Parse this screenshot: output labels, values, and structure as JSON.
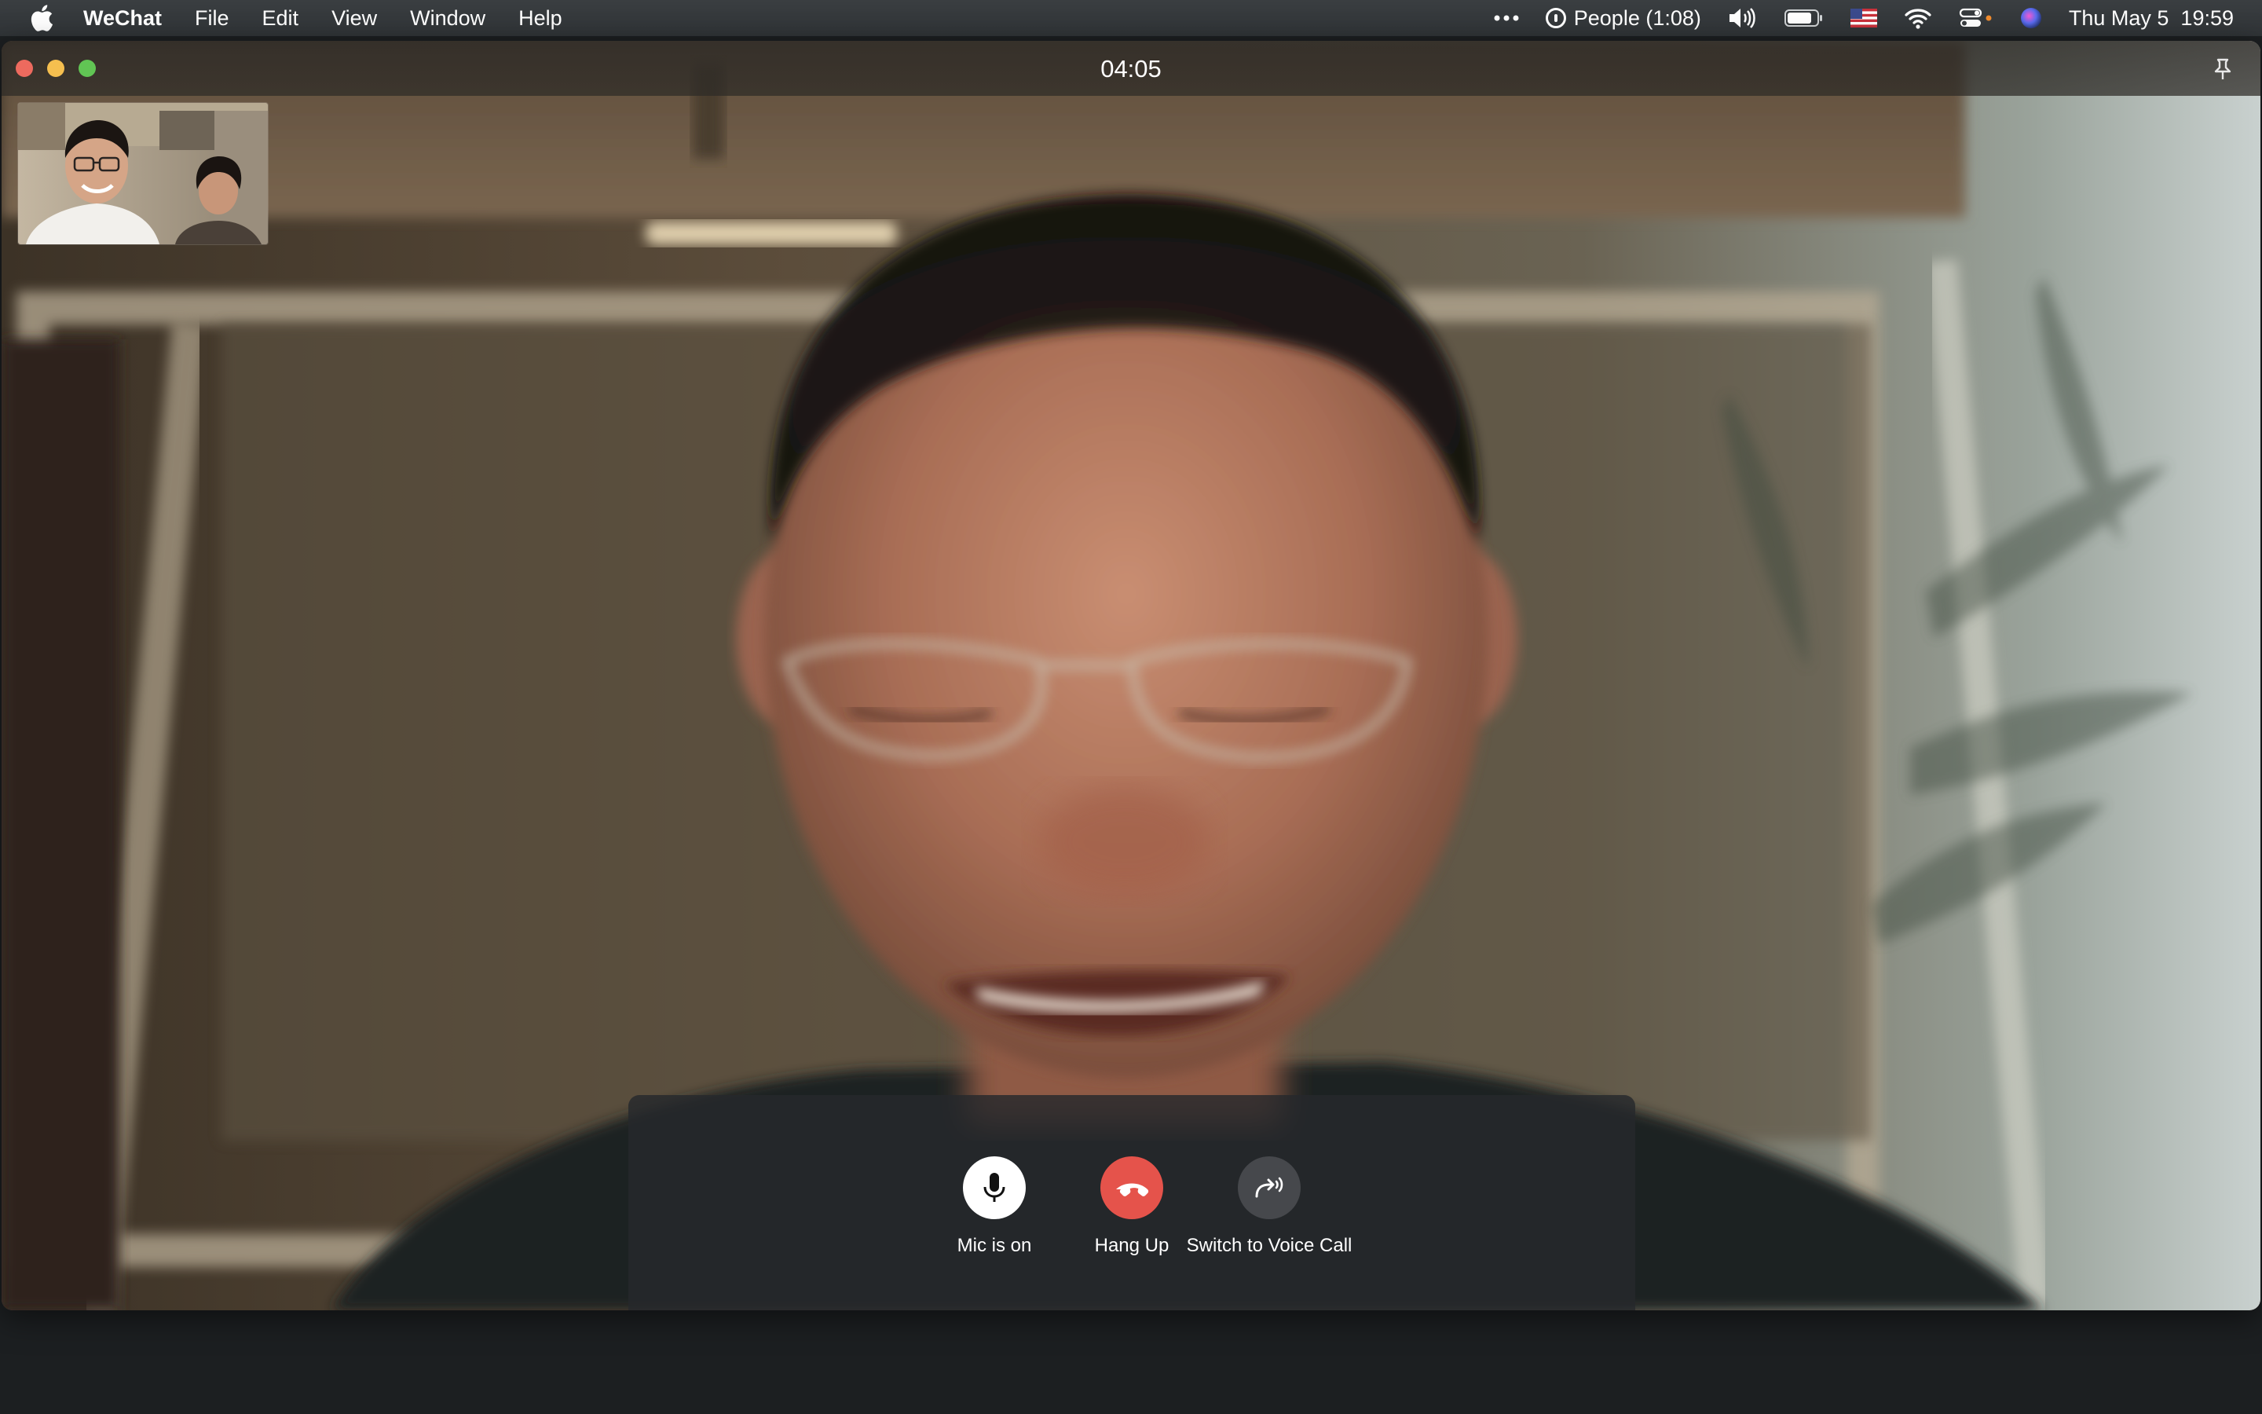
{
  "menubar": {
    "app_name": "WeChat",
    "menus": [
      "File",
      "Edit",
      "View",
      "Window",
      "Help"
    ],
    "people_status": "People (1:08)",
    "datetime": "Thu May 5  19:59",
    "icons": [
      "apple-icon",
      "more-icon",
      "volume-icon",
      "battery-icon",
      "us-flag-icon",
      "wifi-icon",
      "control-center-icon",
      "siri-icon"
    ]
  },
  "window": {
    "timer": "04:05"
  },
  "controls": {
    "mic_label": "Mic is on",
    "hangup_label": "Hang Up",
    "voice_label": "Switch to Voice Call"
  },
  "colors": {
    "hangup": "#e5534b",
    "mic": "#ffffff",
    "voice": "#46484c"
  }
}
